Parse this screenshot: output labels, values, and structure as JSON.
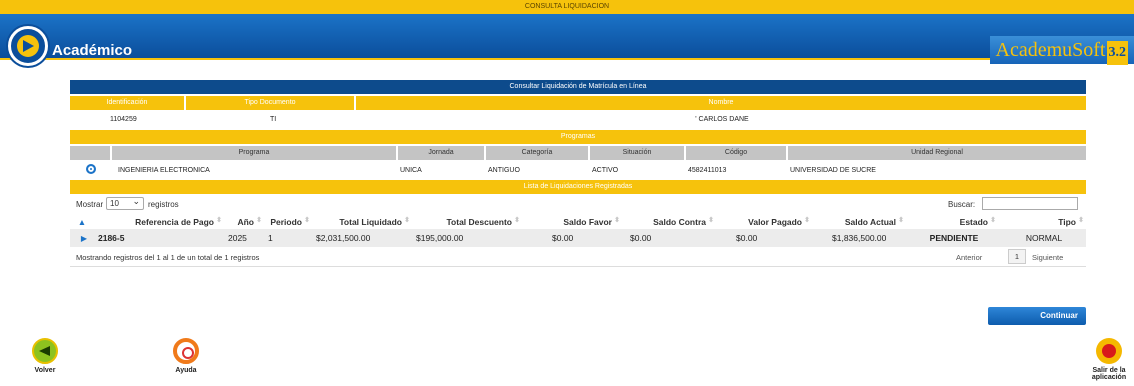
{
  "topbar": {
    "title": "CONSULTA LIQUIDACION"
  },
  "header": {
    "app_title": "Académico",
    "brand": "AcademuSoft",
    "brand_version": "3.2"
  },
  "panel": {
    "title": "Consultar Liquidación de Matrícula en Línea",
    "student_headers": {
      "id": "Identificación",
      "doc_type": "Tipo Documento",
      "name": "Nombre"
    },
    "student": {
      "id": "1104259",
      "doc_type": "TI",
      "name": "' CARLOS DANE"
    },
    "programs_title": "Programas",
    "program_headers": {
      "program": "Programa",
      "jornada": "Jornada",
      "categoria": "Categoría",
      "situacion": "Situación",
      "codigo": "Código",
      "unidad": "Unidad Regional"
    },
    "program": {
      "program": "INGENIERIA ELECTRONICA",
      "jornada": "UNICA",
      "categoria": "ANTIGUO",
      "situacion": "ACTIVO",
      "codigo": "4582411013",
      "unidad": "UNIVERSIDAD DE SUCRE"
    },
    "list_title": "Lista de Liquidaciones Registradas"
  },
  "table_controls": {
    "show_label": "Mostrar",
    "page_size": "10",
    "records_label": "registros",
    "search_label": "Buscar:",
    "search_value": ""
  },
  "columns": [
    "Referencia de Pago",
    "Año",
    "Periodo",
    "Total Liquidado",
    "Total Descuento",
    "Saldo Favor",
    "Saldo Contra",
    "Valor Pagado",
    "Saldo Actual",
    "Estado",
    "Tipo"
  ],
  "rows": [
    {
      "ref": "2186-5",
      "year": "2025",
      "period": "1",
      "total": "$2,031,500.00",
      "discount": "$195,000.00",
      "favor": "$0.00",
      "contra": "$0.00",
      "paid": "$0.00",
      "current": "$1,836,500.00",
      "estado": "PENDIENTE",
      "tipo": "NORMAL"
    }
  ],
  "footer": {
    "info": "Mostrando registros del 1 al 1 de un total de 1 registros",
    "prev": "Anterior",
    "page": "1",
    "next": "Siguiente"
  },
  "actions": {
    "continue": "Continuar",
    "back": "Volver",
    "help": "Ayuda",
    "exit": "Salir de la aplicación"
  },
  "icons": {
    "back": "arrow-left-icon",
    "help": "lifebuoy-icon",
    "exit": "power-icon"
  },
  "colors": {
    "primary_blue": "#0d4b8c",
    "accent_yellow": "#f6c20c"
  }
}
